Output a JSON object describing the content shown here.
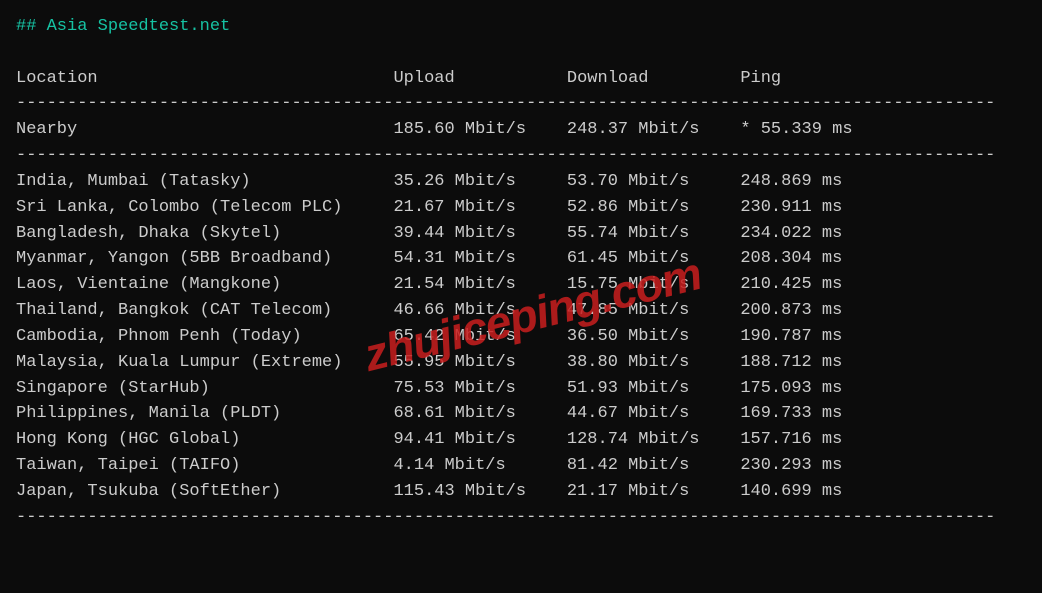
{
  "title": "## Asia Speedtest.net",
  "headers": {
    "location": "Location",
    "upload": "Upload",
    "download": "Download",
    "ping": "Ping"
  },
  "nearby": {
    "location": "Nearby",
    "upload": "185.60 Mbit/s",
    "download": "248.37 Mbit/s",
    "ping": "* 55.339 ms"
  },
  "rows": [
    {
      "location": "India, Mumbai (Tatasky)",
      "upload": "35.26 Mbit/s",
      "download": "53.70 Mbit/s",
      "ping": "248.869 ms"
    },
    {
      "location": "Sri Lanka, Colombo (Telecom PLC)",
      "upload": "21.67 Mbit/s",
      "download": "52.86 Mbit/s",
      "ping": "230.911 ms"
    },
    {
      "location": "Bangladesh, Dhaka (Skytel)",
      "upload": "39.44 Mbit/s",
      "download": "55.74 Mbit/s",
      "ping": "234.022 ms"
    },
    {
      "location": "Myanmar, Yangon (5BB Broadband)",
      "upload": "54.31 Mbit/s",
      "download": "61.45 Mbit/s",
      "ping": "208.304 ms"
    },
    {
      "location": "Laos, Vientaine (Mangkone)",
      "upload": "21.54 Mbit/s",
      "download": "15.75 Mbit/s",
      "ping": "210.425 ms"
    },
    {
      "location": "Thailand, Bangkok (CAT Telecom)",
      "upload": "46.66 Mbit/s",
      "download": "47.85 Mbit/s",
      "ping": "200.873 ms"
    },
    {
      "location": "Cambodia, Phnom Penh (Today)",
      "upload": "65.42 Mbit/s",
      "download": "36.50 Mbit/s",
      "ping": "190.787 ms"
    },
    {
      "location": "Malaysia, Kuala Lumpur (Extreme)",
      "upload": "55.95 Mbit/s",
      "download": "38.80 Mbit/s",
      "ping": "188.712 ms"
    },
    {
      "location": "Singapore (StarHub)",
      "upload": "75.53 Mbit/s",
      "download": "51.93 Mbit/s",
      "ping": "175.093 ms"
    },
    {
      "location": "Philippines, Manila (PLDT)",
      "upload": "68.61 Mbit/s",
      "download": "44.67 Mbit/s",
      "ping": "169.733 ms"
    },
    {
      "location": "Hong Kong (HGC Global)",
      "upload": "94.41 Mbit/s",
      "download": "128.74 Mbit/s",
      "ping": "157.716 ms"
    },
    {
      "location": "Taiwan, Taipei (TAIFO)",
      "upload": "4.14 Mbit/s",
      "download": "81.42 Mbit/s",
      "ping": "230.293 ms"
    },
    {
      "location": "Japan, Tsukuba (SoftEther)",
      "upload": "115.43 Mbit/s",
      "download": "21.17 Mbit/s",
      "ping": "140.699 ms"
    }
  ],
  "watermark": "zhujiceping.com"
}
